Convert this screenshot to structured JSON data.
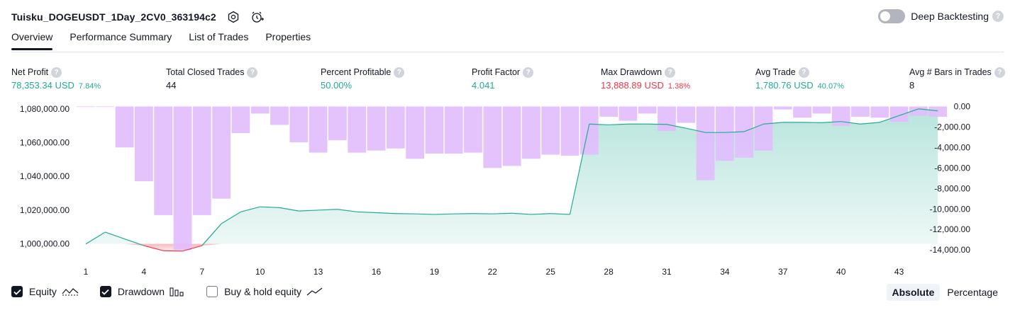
{
  "header": {
    "strategy_name": "Tuisku_DOGEUSDT_1Day_2CV0_363194c2",
    "deep_backtesting_label": "Deep Backtesting",
    "deep_backtesting_enabled": false
  },
  "tabs": [
    {
      "label": "Overview",
      "active": true
    },
    {
      "label": "Performance Summary",
      "active": false
    },
    {
      "label": "List of Trades",
      "active": false
    },
    {
      "label": "Properties",
      "active": false
    }
  ],
  "metrics": {
    "net_profit": {
      "label": "Net Profit",
      "value": "78,353.34 USD",
      "pct": "7.84%"
    },
    "total_closed_trades": {
      "label": "Total Closed Trades",
      "value": "44"
    },
    "percent_profitable": {
      "label": "Percent Profitable",
      "value": "50.00%"
    },
    "profit_factor": {
      "label": "Profit Factor",
      "value": "4.041"
    },
    "max_drawdown": {
      "label": "Max Drawdown",
      "value": "13,888.89 USD",
      "pct": "1.38%"
    },
    "avg_trade": {
      "label": "Avg Trade",
      "value": "1,780.76 USD",
      "pct": "40.07%"
    },
    "avg_bars": {
      "label": "Avg # Bars in Trades",
      "value": "8"
    }
  },
  "chart_data": {
    "type": "area",
    "x_ticks": [
      "1",
      "4",
      "7",
      "10",
      "13",
      "16",
      "19",
      "22",
      "25",
      "28",
      "31",
      "34",
      "37",
      "40",
      "43"
    ],
    "y_left_ticks": [
      "1,080,000.00",
      "1,060,000.00",
      "1,040,000.00",
      "1,020,000.00",
      "1,000,000.00"
    ],
    "y_left_range": [
      994000,
      1082000
    ],
    "y_right_ticks": [
      "0.00",
      "-2,000.00",
      "-4,000.00",
      "-6,000.00",
      "-8,000.00",
      "-10,000.00",
      "-12,000.00",
      "-14,000.00"
    ],
    "y_right_range": [
      -14400,
      100
    ],
    "baseline_equity": 1000000,
    "equity": [
      1000000,
      1007000,
      1003000,
      999000,
      996000,
      995800,
      999000,
      1012000,
      1019000,
      1022000,
      1021500,
      1019500,
      1020000,
      1020500,
      1019000,
      1018500,
      1018000,
      1017800,
      1017500,
      1017800,
      1018000,
      1017800,
      1018200,
      1017500,
      1018000,
      1017500,
      1071000,
      1070500,
      1071000,
      1071000,
      1070800,
      1068500,
      1066000,
      1066000,
      1066500,
      1071000,
      1072000,
      1072000,
      1071800,
      1072500,
      1071000,
      1072000,
      1076000,
      1080000,
      1078800
    ],
    "drawdown": [
      0,
      -50,
      -4000,
      -7300,
      -10600,
      -14000,
      -10600,
      -9000,
      -2600,
      -700,
      -1800,
      -3500,
      -4500,
      -3300,
      -4500,
      -4300,
      -4100,
      -5100,
      -4600,
      -4600,
      -4500,
      -6000,
      -5800,
      -5100,
      -4700,
      -4800,
      -4700,
      -1000,
      -1400,
      -700,
      -2400,
      -1600,
      -7200,
      -5300,
      -5000,
      -4300,
      -300,
      -1100,
      -700,
      -1900,
      -1000,
      -1100,
      -1500,
      -900,
      -1000
    ],
    "legend": {
      "equity": "Equity",
      "drawdown": "Drawdown",
      "buy_hold": "Buy & hold equity"
    },
    "legend_state": {
      "equity": true,
      "drawdown": true,
      "buy_hold": false
    }
  },
  "scale_modes": [
    {
      "label": "Absolute",
      "active": true
    },
    {
      "label": "Percentage",
      "active": false
    }
  ],
  "colors": {
    "green": "#22ab94",
    "red": "#f23645",
    "equity_line": "#22ab94",
    "drawdown_fill": "#e1bdfd",
    "text": "#131722"
  }
}
